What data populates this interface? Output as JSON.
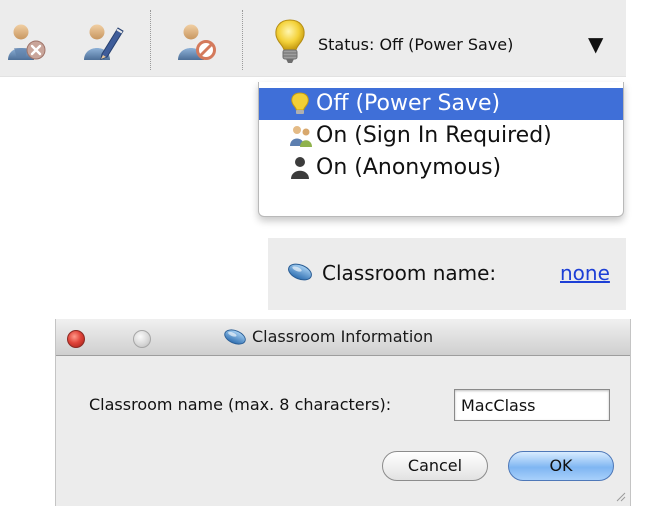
{
  "toolbar": {
    "buttons": [
      {
        "icon": "remove-user-icon"
      },
      {
        "icon": "edit-user-icon"
      },
      {
        "icon": "block-user-icon"
      }
    ],
    "status": {
      "icon": "lightbulb-icon",
      "label": "Status: Off (Power Save)",
      "dropdown_icon": "triangle-down-icon"
    }
  },
  "status_menu": {
    "items": [
      {
        "label": "Off (Power Save)",
        "icon": "lightbulb-icon",
        "selected": true
      },
      {
        "label": "On (Sign In Required)",
        "icon": "users-icon",
        "selected": false
      },
      {
        "label": "On (Anonymous)",
        "icon": "anonymous-user-icon",
        "selected": false
      }
    ]
  },
  "classroom_bar": {
    "icon": "classroom-pill-icon",
    "label": "Classroom name:",
    "link": "none"
  },
  "dialog": {
    "title": "Classroom Information",
    "title_icon": "classroom-pill-icon",
    "field_label": "Classroom name (max. 8 characters):",
    "field_value": "MacClass",
    "cancel_label": "Cancel",
    "ok_label": "OK"
  },
  "colors": {
    "menu_highlight": "#3f6fd8",
    "link": "#1d3fd6",
    "toolbar_bg": "#ececec",
    "ok_button": "#7fb6f2",
    "close_button": "#e0443a"
  }
}
